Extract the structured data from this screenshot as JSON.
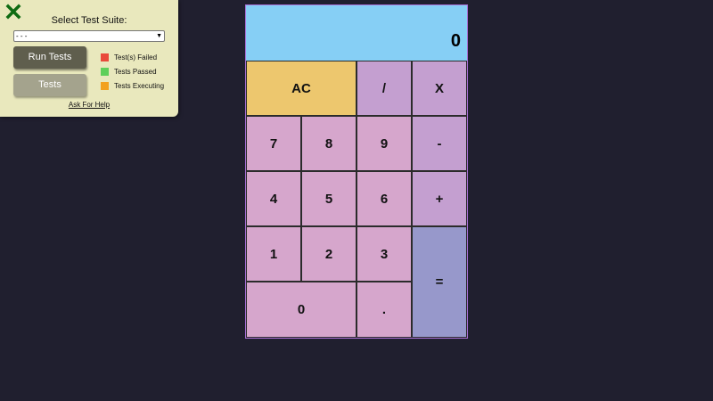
{
  "test_panel": {
    "close_icon": "close-x-icon",
    "title": "Select Test Suite:",
    "suite_select_value": "- - -",
    "run_button": "Run Tests",
    "tests_button": "Tests",
    "legend": [
      {
        "label": "Test(s) Failed",
        "color": "#e94a3b"
      },
      {
        "label": "Tests Passed",
        "color": "#5fcf5a"
      },
      {
        "label": "Tests Executing",
        "color": "#f2a11f"
      }
    ],
    "help_link": "Ask For Help"
  },
  "calculator": {
    "display": "0",
    "keys": {
      "clear": "AC",
      "divide": "/",
      "multiply": "X",
      "seven": "7",
      "eight": "8",
      "nine": "9",
      "subtract": "-",
      "four": "4",
      "five": "5",
      "six": "6",
      "add": "+",
      "one": "1",
      "two": "2",
      "three": "3",
      "equals": "=",
      "zero": "0",
      "decimal": "."
    },
    "colors": {
      "display": "#86cff5",
      "number_key": "#d6a6cc",
      "operator_key": "#c49fd0",
      "clear_key": "#edc76e",
      "equals_key": "#9798cb",
      "background": "#201f2f",
      "panel": "#e9e8bd"
    }
  }
}
